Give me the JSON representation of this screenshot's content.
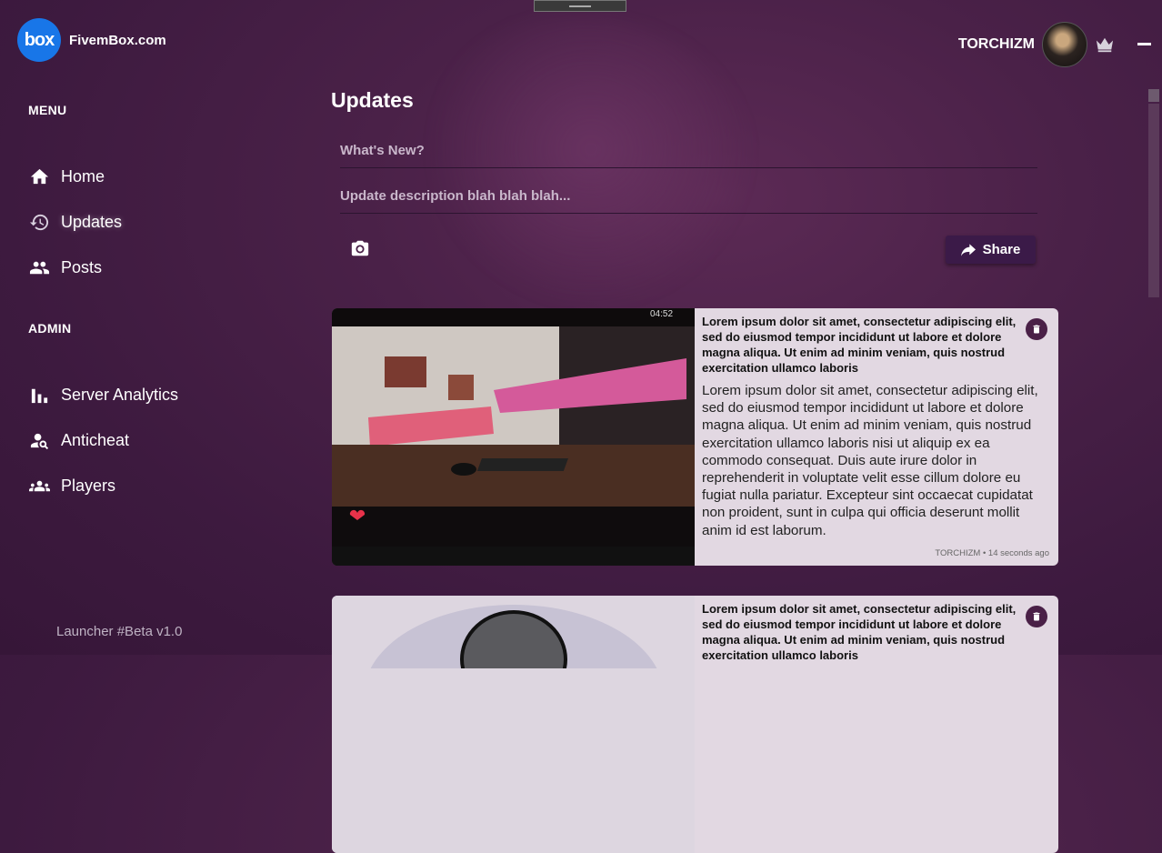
{
  "brand": {
    "logo_text": "box",
    "name": "FivemBox.com"
  },
  "user": {
    "name": "TORCHIZM"
  },
  "sidebar": {
    "menu_heading": "MENU",
    "menu_items": [
      {
        "label": "Home",
        "icon": "home-icon"
      },
      {
        "label": "Updates",
        "icon": "history-icon"
      },
      {
        "label": "Posts",
        "icon": "people-icon"
      }
    ],
    "admin_heading": "ADMIN",
    "admin_items": [
      {
        "label": "Server Analytics",
        "icon": "bar-chart-icon"
      },
      {
        "label": "Anticheat",
        "icon": "person-search-icon"
      },
      {
        "label": "Players",
        "icon": "group-icon"
      }
    ],
    "version": "Launcher #Beta v1.0"
  },
  "main": {
    "title": "Updates",
    "title_placeholder": "What's New?",
    "description_placeholder": "Update description blah blah blah...",
    "share_label": "Share"
  },
  "posts": [
    {
      "title": "Lorem ipsum dolor sit amet, consectetur adipiscing elit, sed do eiusmod tempor incididunt ut labore et dolore magna aliqua. Ut enim ad minim veniam, quis nostrud exercitation ullamco laboris",
      "body": "Lorem ipsum dolor sit amet, consectetur adipiscing elit, sed do eiusmod tempor incididunt ut labore et dolore magna aliqua. Ut enim ad minim veniam, quis nostrud exercitation ullamco laboris nisi ut aliquip ex ea commodo consequat. Duis aute irure dolor in reprehenderit in voluptate velit esse cillum dolore eu fugiat nulla pariatur. Excepteur sint occaecat cupidatat non proident, sunt in culpa qui officia deserunt mollit anim id est laborum.",
      "meta": "TORCHIZM • 14 seconds ago",
      "phone_time": "04:52"
    },
    {
      "title": "Lorem ipsum dolor sit amet, consectetur adipiscing elit, sed do eiusmod tempor incididunt ut labore et dolore magna aliqua. Ut enim ad minim veniam, quis nostrud exercitation ullamco laboris"
    }
  ],
  "colors": {
    "accent": "#3b1a48",
    "logo_blue": "#1876e8",
    "card_bg": "#e2d8e2"
  }
}
